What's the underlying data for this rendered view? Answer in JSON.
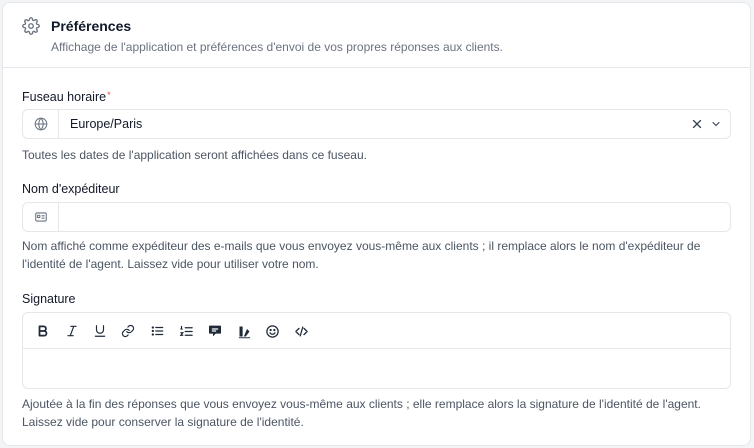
{
  "header": {
    "title": "Préférences",
    "subtitle": "Affichage de l'application et préférences d'envoi de vos propres réponses aux clients.",
    "icon": "gear-icon"
  },
  "timezone": {
    "label": "Fuseau horaire",
    "required_mark": "*",
    "value": "Europe/Paris",
    "help": "Toutes les dates de l'application seront affichées dans ce fuseau."
  },
  "sender_name": {
    "label": "Nom d'expéditeur",
    "value": "",
    "placeholder": "",
    "help": "Nom affiché comme expéditeur des e-mails que vous envoyez vous-même aux clients ; il remplace alors le nom d'expéditeur de l'identité de l'agent. Laissez vide pour utiliser votre nom."
  },
  "signature": {
    "label": "Signature",
    "toolbar": [
      "bold-icon",
      "italic-icon",
      "underline-icon",
      "link-icon",
      "bullet-list-icon",
      "numbered-list-icon",
      "comment-icon",
      "highlight-icon",
      "emoji-icon",
      "code-icon"
    ],
    "help": "Ajoutée à la fin des réponses que vous envoyez vous-même aux clients ; elle remplace alors la signature de l'identité de l'agent. Laissez vide pour conserver la signature de l'identité."
  },
  "colors": {
    "required": "#ef4444",
    "border": "#e5e7eb",
    "muted_text": "#6b7280"
  }
}
